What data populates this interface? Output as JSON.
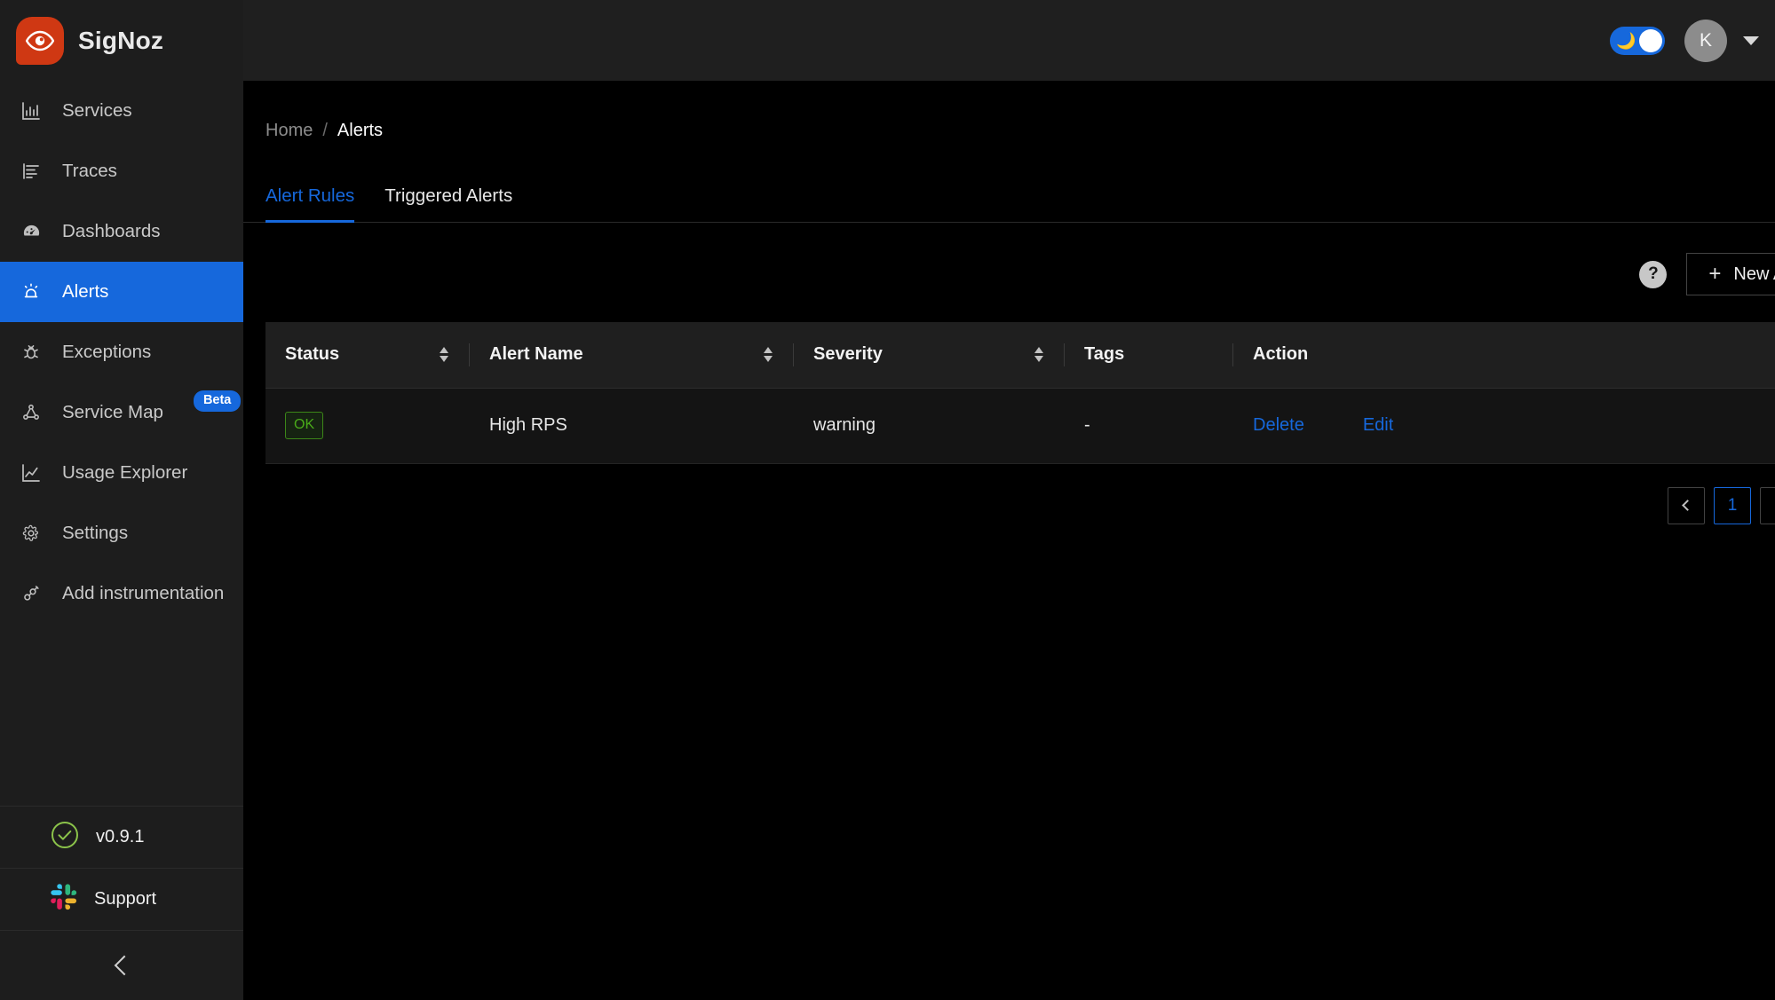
{
  "brand": {
    "name": "SigNoz",
    "logo_icon": "eye-icon"
  },
  "header": {
    "theme_toggle": {
      "icon": "moon-icon",
      "state": "dark"
    },
    "avatar_initial": "K",
    "caret_icon": "chevron-down-icon"
  },
  "sidebar": {
    "items": [
      {
        "label": "Services",
        "icon": "bar-chart-icon",
        "active": false
      },
      {
        "label": "Traces",
        "icon": "list-lines-icon",
        "active": false
      },
      {
        "label": "Dashboards",
        "icon": "gauge-icon",
        "active": false
      },
      {
        "label": "Alerts",
        "icon": "alarm-siren-icon",
        "active": true
      },
      {
        "label": "Exceptions",
        "icon": "bug-icon",
        "active": false
      },
      {
        "label": "Service Map",
        "icon": "node-graph-icon",
        "badge": "Beta",
        "active": false
      },
      {
        "label": "Usage Explorer",
        "icon": "line-chart-icon",
        "active": false
      },
      {
        "label": "Settings",
        "icon": "gear-icon",
        "active": false
      },
      {
        "label": "Add instrumentation",
        "icon": "plug-icon",
        "active": false
      }
    ],
    "version": {
      "label": "v0.9.1",
      "icon": "check-circle-icon"
    },
    "support": {
      "label": "Support",
      "icon": "slack-icon"
    },
    "collapse_icon": "chevron-left-icon"
  },
  "breadcrumb": {
    "home": "Home",
    "separator": "/",
    "current": "Alerts"
  },
  "tabs": [
    {
      "label": "Alert Rules",
      "active": true
    },
    {
      "label": "Triggered Alerts",
      "active": false
    }
  ],
  "toolbar": {
    "help_label": "?",
    "new_alert_label": "New Alert",
    "plus_icon": "plus-icon"
  },
  "table": {
    "columns": [
      {
        "label": "Status",
        "sortable": true
      },
      {
        "label": "Alert Name",
        "sortable": true
      },
      {
        "label": "Severity",
        "sortable": true
      },
      {
        "label": "Tags",
        "sortable": false
      },
      {
        "label": "Action",
        "sortable": false
      }
    ],
    "rows": [
      {
        "status": "OK",
        "alert_name": "High RPS",
        "severity": "warning",
        "tags": "-",
        "delete_label": "Delete",
        "edit_label": "Edit"
      }
    ]
  },
  "pagination": {
    "prev_icon": "chevron-left-icon",
    "pages": [
      "1"
    ],
    "current_page": "1",
    "next_icon": "chevron-right-icon"
  },
  "colors": {
    "accent": "#1668dc",
    "brand": "#cf3813",
    "status_ok": "#49aa19",
    "sidebar_bg": "#1d1d1d",
    "main_bg": "#000000",
    "table_header_bg": "#1f1f1f",
    "table_row_bg": "#141414"
  }
}
